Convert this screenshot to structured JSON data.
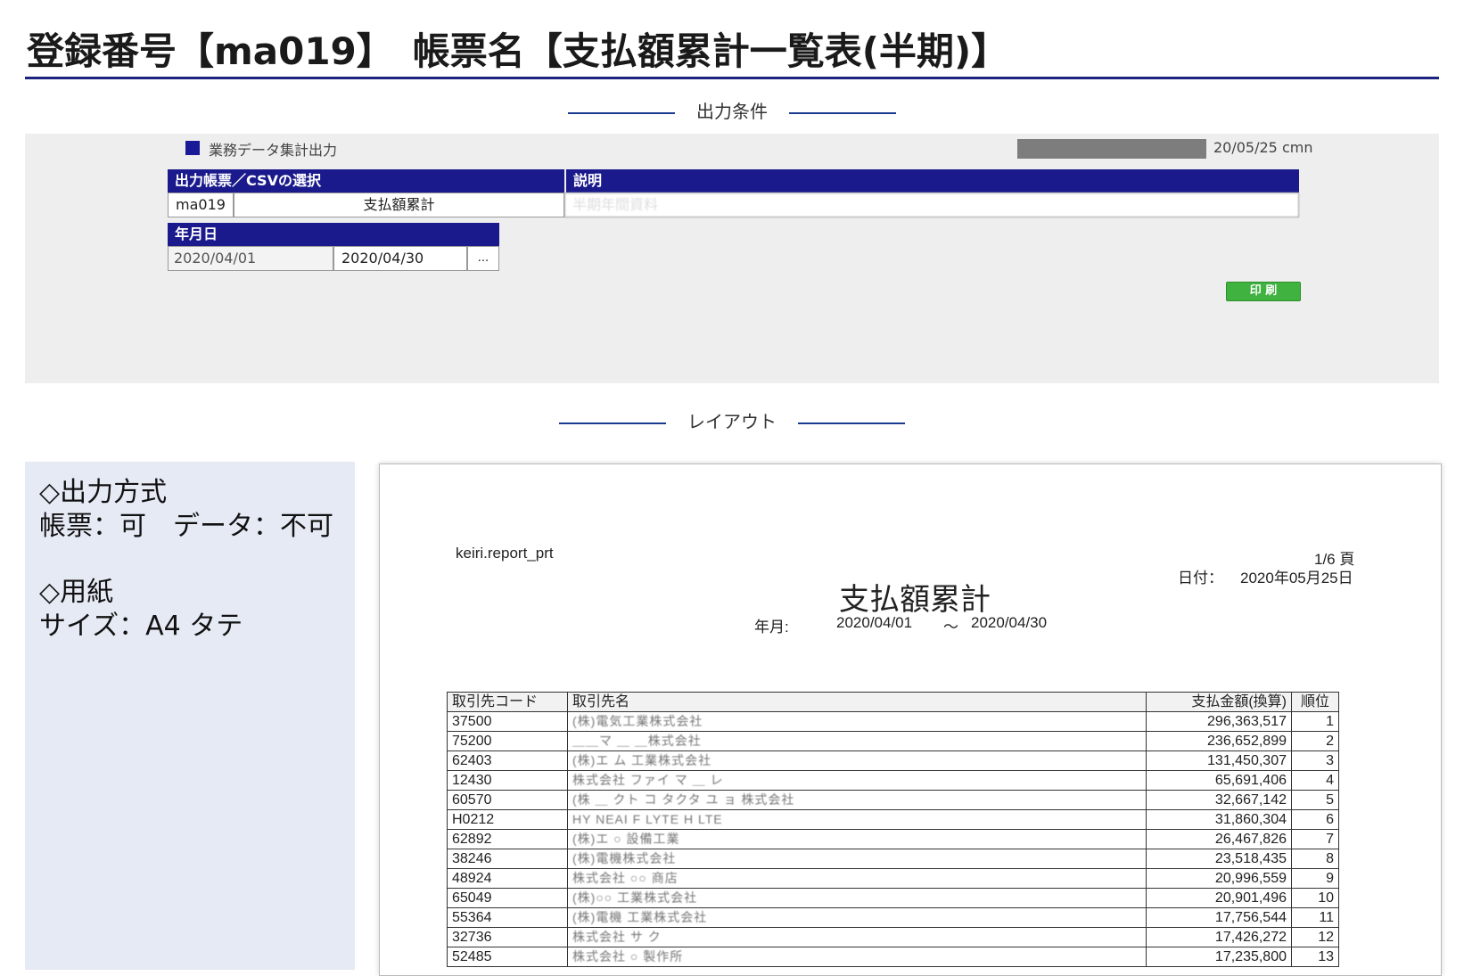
{
  "header": {
    "title": "登録番号【ma019】　帳票名【支払額累計一覧表(半期)】"
  },
  "sections": {
    "conditions": "出力条件",
    "layout": "レイアウト"
  },
  "conditions_panel": {
    "menu_label": "業務データ集計出力",
    "stamp": "20/05/25 cmn",
    "select_header": "出力帳票／CSVの選択",
    "desc_header": "説明",
    "report_code": "ma019",
    "report_name": "支払額累計",
    "description": "半期年間資料",
    "date_header": "年月日",
    "date_from": "2020/04/01",
    "date_to": "2020/04/30",
    "date_picker": "...",
    "print_button": "印 刷"
  },
  "info": {
    "line1": "◇出力方式",
    "line2": "帳票：可　データ：不可",
    "line3": "◇用紙",
    "line4": "サイズ：A4 タテ"
  },
  "report": {
    "source": "keiri.report_prt",
    "page": "1/6 頁",
    "date_label": "日付：",
    "date": "2020年05月25日",
    "title": "支払額累計",
    "period_label": "年月:",
    "period_from": "2020/04/01",
    "period_sep": "～",
    "period_to": "2020/04/30",
    "columns": [
      "取引先コード",
      "取引先名",
      "支払金額(換算)",
      "順位"
    ],
    "rows": [
      {
        "code": "37500",
        "name": "(株)電気工業株式会社",
        "amount": "296,363,517",
        "rank": "1"
      },
      {
        "code": "75200",
        "name": "＿＿マ ＿ ＿株式会社",
        "amount": "236,652,899",
        "rank": "2"
      },
      {
        "code": "62403",
        "name": "(株)エ ム 工業株式会社",
        "amount": "131,450,307",
        "rank": "3"
      },
      {
        "code": "12430",
        "name": "株式会社 ファイ マ ＿ レ",
        "amount": "65,691,406",
        "rank": "4"
      },
      {
        "code": "60570",
        "name": "(株 ＿ クト コ タクタ ユ ョ 株式会社",
        "amount": "32,667,142",
        "rank": "5"
      },
      {
        "code": "H0212",
        "name": "HY NEAI F LYTE H LTE",
        "amount": "31,860,304",
        "rank": "6"
      },
      {
        "code": "62892",
        "name": "(株)エ ○ 設備工業",
        "amount": "26,467,826",
        "rank": "7"
      },
      {
        "code": "38246",
        "name": "(株)電機株式会社",
        "amount": "23,518,435",
        "rank": "8"
      },
      {
        "code": "48924",
        "name": "株式会社 ○○ 商店",
        "amount": "20,996,559",
        "rank": "9"
      },
      {
        "code": "65049",
        "name": "(株)○○ 工業株式会社",
        "amount": "20,901,496",
        "rank": "10"
      },
      {
        "code": "55364",
        "name": "(株)電機 工業株式会社",
        "amount": "17,756,544",
        "rank": "11"
      },
      {
        "code": "32736",
        "name": "株式会社 サ ク",
        "amount": "17,426,272",
        "rank": "12"
      },
      {
        "code": "52485",
        "name": "株式会社 ○ 製作所",
        "amount": "17,235,800",
        "rank": "13"
      }
    ]
  },
  "colors": {
    "navy": "#1a1a8c",
    "accent_line": "#1a3a8f",
    "print_green": "#3fb23f"
  }
}
